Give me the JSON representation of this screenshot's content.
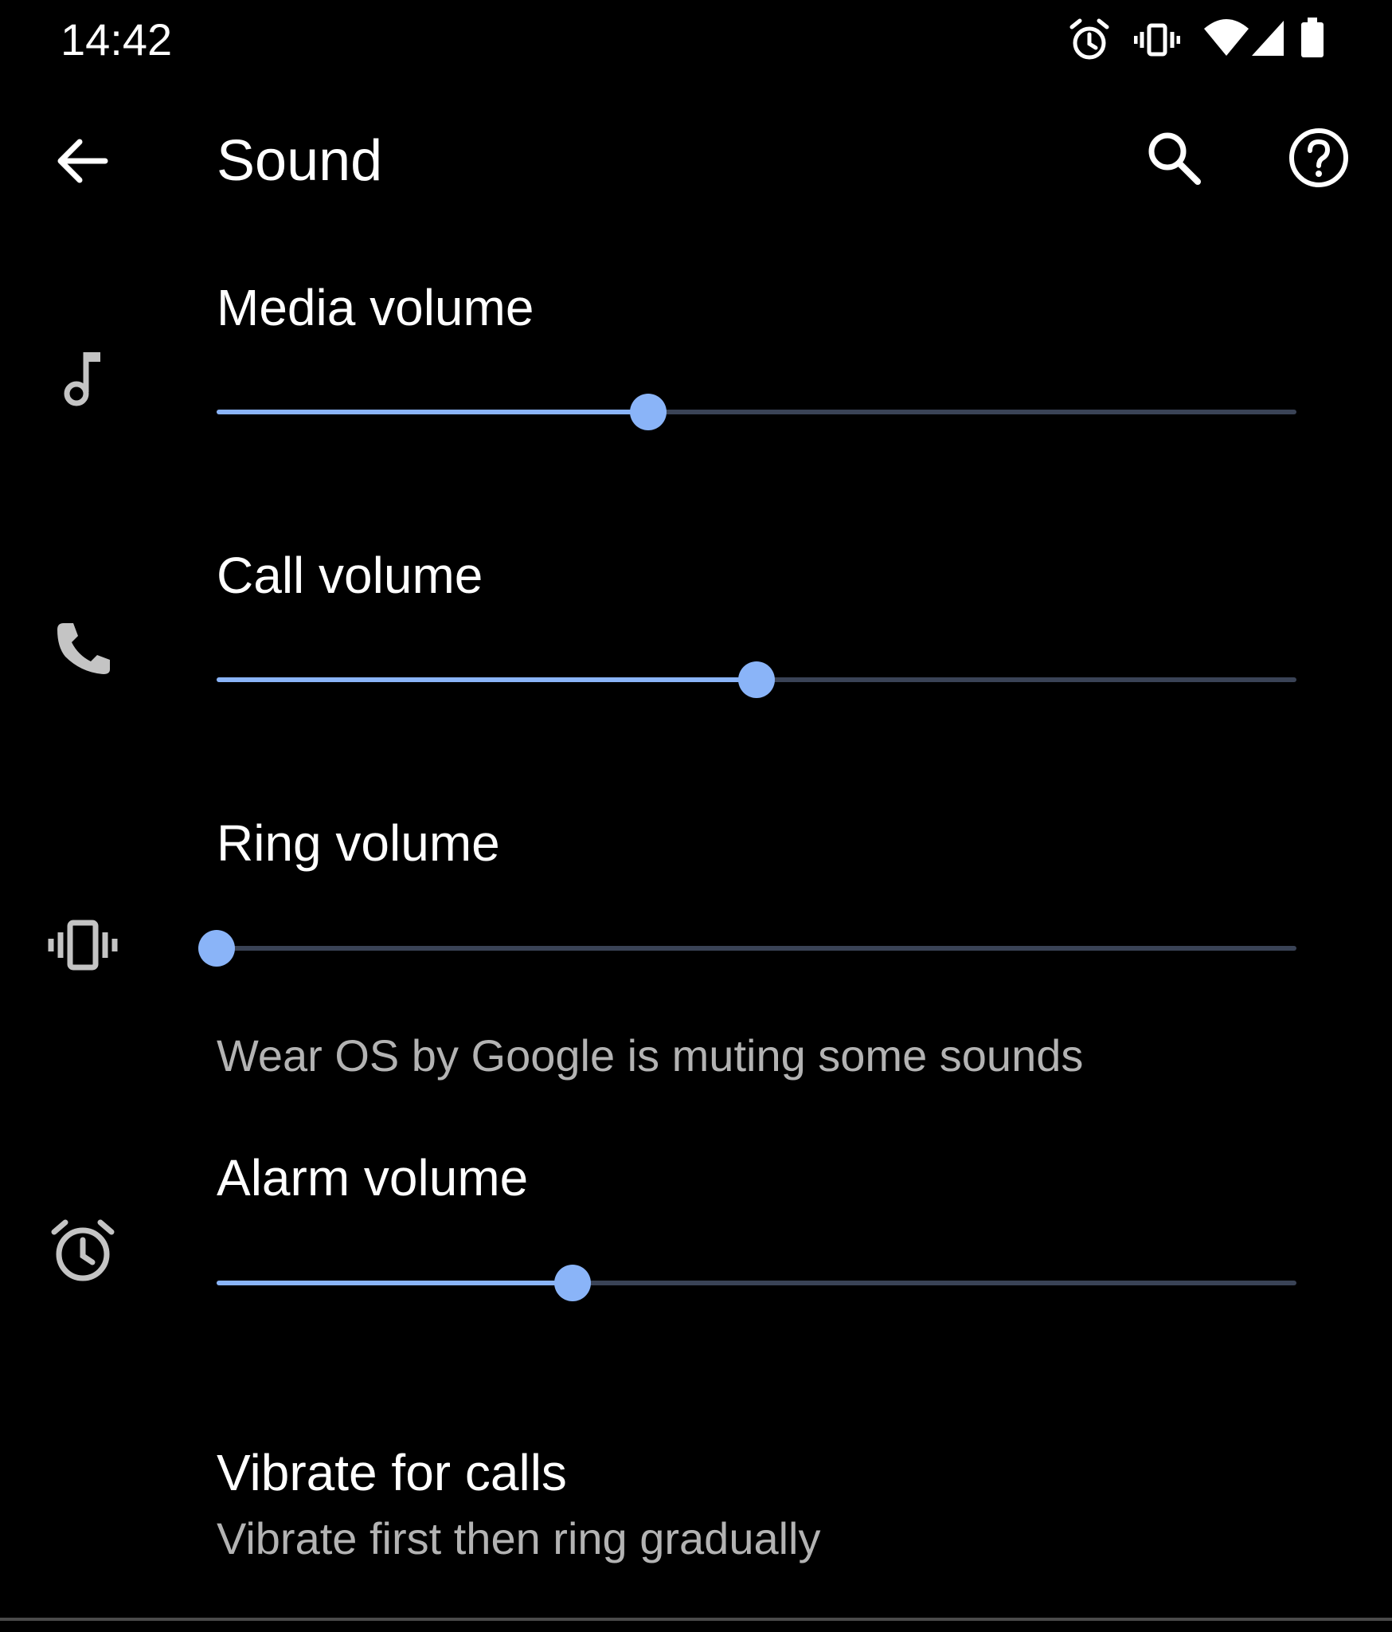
{
  "status_bar": {
    "time": "14:42",
    "icons": [
      "alarm-icon",
      "vibrate-icon",
      "wifi-icon",
      "cell-signal-icon",
      "battery-icon"
    ]
  },
  "toolbar": {
    "title": "Sound",
    "icons": [
      "back-arrow-icon",
      "search-icon",
      "help-icon"
    ]
  },
  "volumes": [
    {
      "id": "media",
      "label": "Media volume",
      "icon": "music-note-icon",
      "level": 0.4
    },
    {
      "id": "call",
      "label": "Call volume",
      "icon": "phone-icon",
      "level": 0.5
    },
    {
      "id": "ring",
      "label": "Ring volume",
      "icon": "vibrate-icon",
      "level": 0.0,
      "note": "Wear OS by Google is muting some sounds"
    },
    {
      "id": "alarm",
      "label": "Alarm volume",
      "icon": "alarm-icon",
      "level": 0.33
    }
  ],
  "vibrate_for_calls": {
    "title": "Vibrate for calls",
    "summary": "Vibrate first then ring gradually"
  },
  "colors": {
    "background": "#000000",
    "accent": "#8ab4f8",
    "track": "#3a4356",
    "secondary_text": "#b3b3b3",
    "icon_gray": "#c4c4c4"
  }
}
